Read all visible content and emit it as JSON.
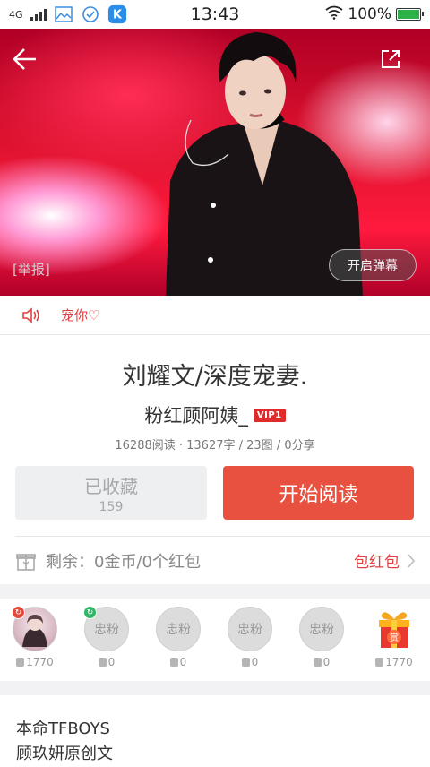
{
  "status_bar": {
    "network": "4G",
    "time": "13:43",
    "battery": "100%"
  },
  "hero": {
    "report_label": "[举报]",
    "danmu_label": "开启弹幕"
  },
  "music": {
    "title": "宠你♡"
  },
  "article": {
    "title": "刘耀文/深度宠妻.",
    "author": "粉红顾阿姨_",
    "vip_badge": "VIP1",
    "stats": "16288阅读 · 13627字 / 23图 / 0分享"
  },
  "actions": {
    "favorite_label": "已收藏",
    "favorite_count": "159",
    "read_label": "开始阅读"
  },
  "remain": {
    "text": "剩余：0金币/0个红包",
    "redpack_label": "包红包"
  },
  "fans": [
    {
      "label": "",
      "coins": "1770"
    },
    {
      "label": "忠粉",
      "coins": "0"
    },
    {
      "label": "忠粉",
      "coins": "0"
    },
    {
      "label": "忠粉",
      "coins": "0"
    },
    {
      "label": "忠粉",
      "coins": "0"
    },
    {
      "label": "赏",
      "coins": "1770"
    }
  ],
  "description": {
    "line1": "本命TFBOYS",
    "line2": "顾玖妍原创文"
  },
  "colors": {
    "accent": "#e8513f",
    "link_red": "#e04040",
    "muted": "#a8a8a8"
  }
}
